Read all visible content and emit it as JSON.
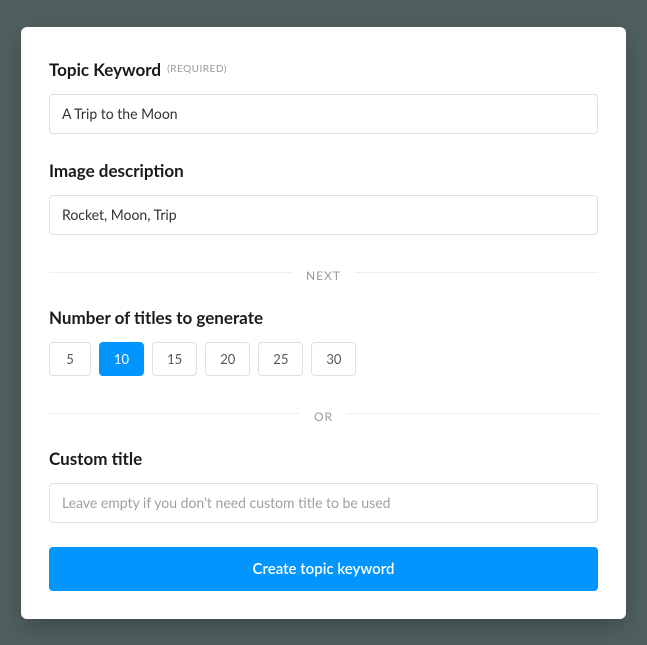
{
  "topic": {
    "label": "Topic Keyword",
    "required_tag": "(REQUIRED)",
    "value": "A Trip to the Moon"
  },
  "image_desc": {
    "label": "Image description",
    "value": "Rocket, Moon, Trip"
  },
  "divider_next": "NEXT",
  "titles": {
    "label": "Number of titles to generate",
    "options": [
      "5",
      "10",
      "15",
      "20",
      "25",
      "30"
    ],
    "selected": "10"
  },
  "divider_or": "OR",
  "custom_title": {
    "label": "Custom title",
    "placeholder": "Leave empty if you don't need custom title to be used",
    "value": ""
  },
  "submit_label": "Create topic keyword"
}
